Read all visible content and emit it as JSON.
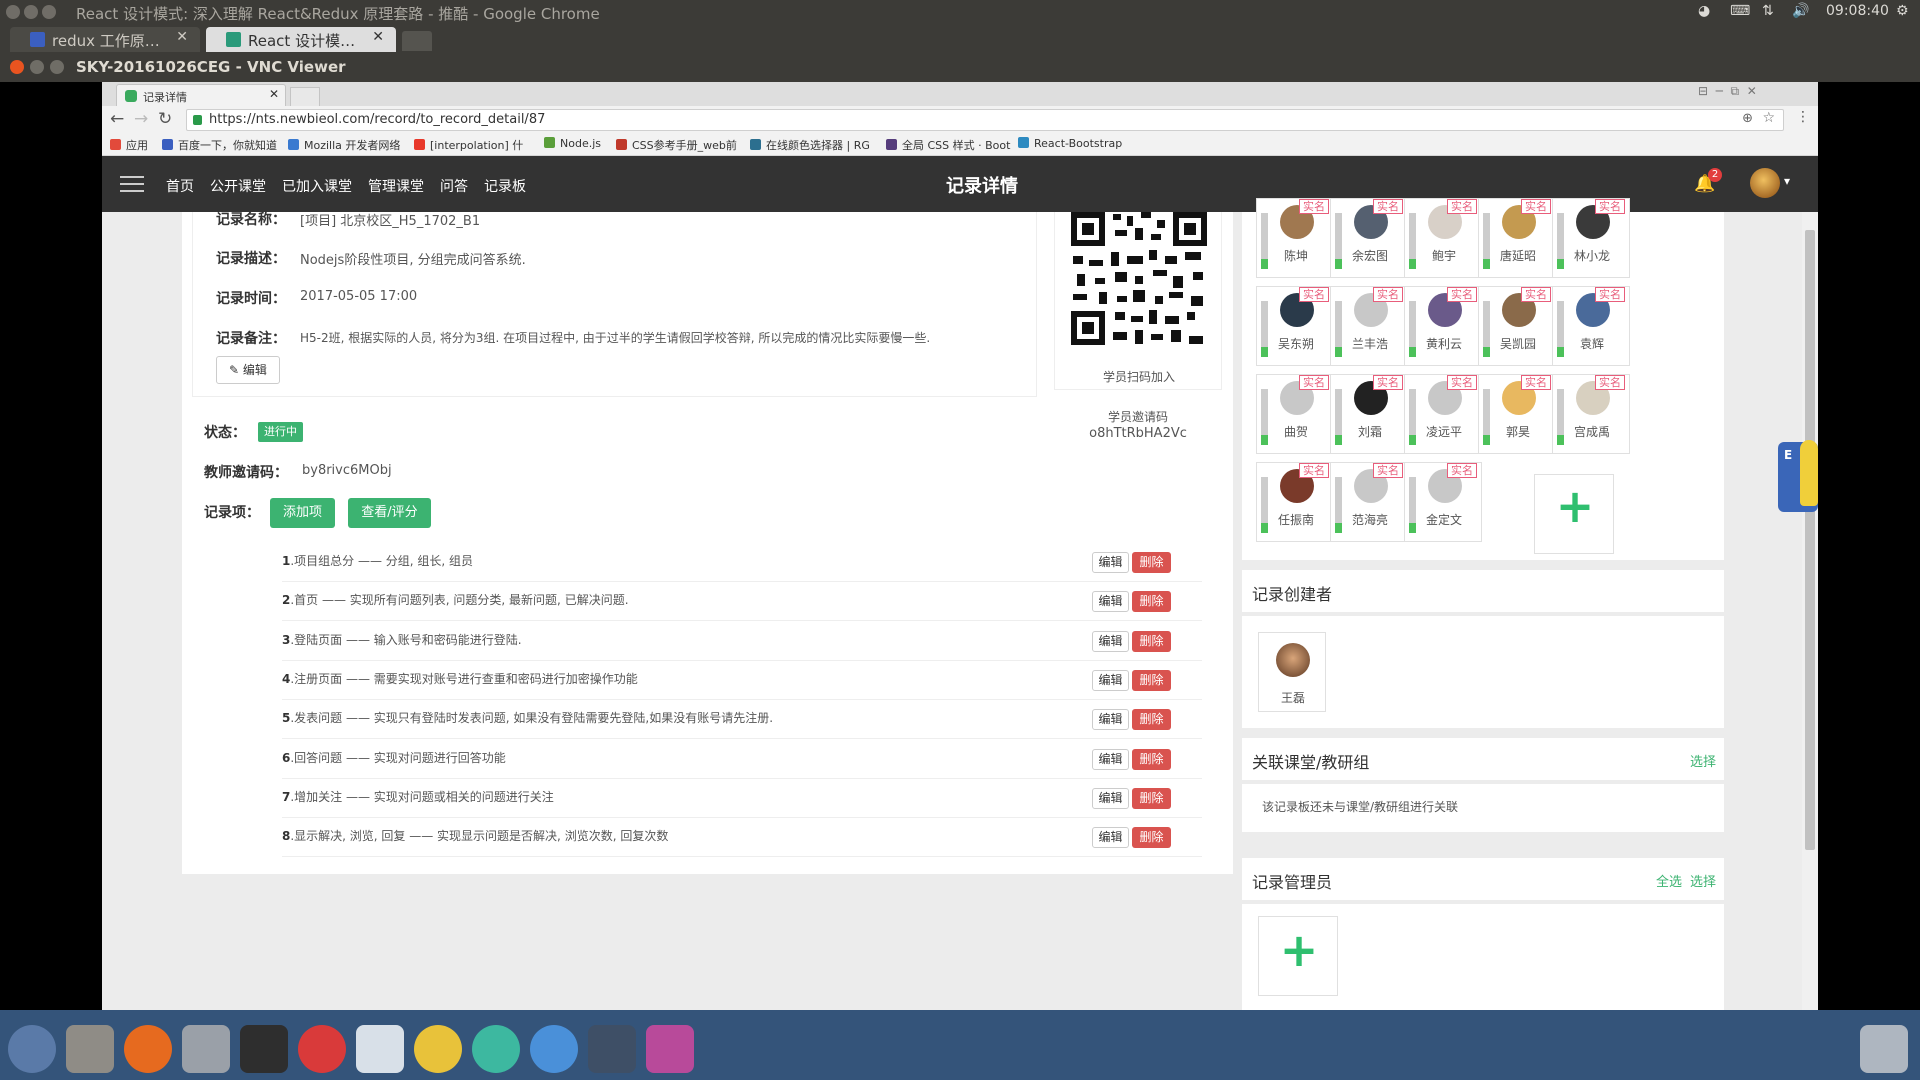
{
  "outer_window": {
    "title": "React 设计模式: 深入理解 React&Redux 原理套路 - 推酷 - Google Chrome",
    "tabs": [
      {
        "label": "redux 工作原理_百"
      },
      {
        "label": "React 设计模式: 深"
      }
    ],
    "clock": "09:08:40"
  },
  "vnc": {
    "title": "SKY-20161026CEG - VNC Viewer"
  },
  "inner_browser": {
    "tab_label": "记录详情",
    "url": "https://nts.newbieol.com/record/to_record_detail/87",
    "bookmarks": [
      "应用",
      "百度一下，你就知道",
      "Mozilla 开发者网络",
      "[interpolation] 什",
      "Node.js",
      "CSS参考手册_web前",
      "在线颜色选择器 | RG",
      "全局 CSS 样式 · Boot",
      "React-Bootstrap"
    ]
  },
  "site_nav": {
    "items": [
      "首页",
      "公开课堂",
      "已加入课堂",
      "管理课堂",
      "问答",
      "记录板"
    ],
    "page_title": "记录详情",
    "notification_count": "2"
  },
  "record": {
    "name_label": "记录名称：",
    "name_value": "[项目] 北京校区_H5_1702_B1",
    "desc_label": "记录描述：",
    "desc_value": "Nodejs阶段性项目, 分组完成问答系统.",
    "time_label": "记录时间：",
    "time_value": "2017-05-05 17:00",
    "note_label": "记录备注：",
    "note_value": "H5-2班, 根据实际的人员, 将分为3组. 在项目过程中, 由于过半的学生请假回学校答辩, 所以完成的情况比实际要慢一些.",
    "edit_label": "编辑",
    "qr_caption": "学员扫码加入",
    "student_code_label": "学员邀请码",
    "student_code": "o8hTtRbHA2Vc",
    "status_label": "状态：",
    "status_value": "进行中",
    "teacher_code_label": "教师邀请码：",
    "teacher_code": "by8rivc6MObj",
    "items_label": "记录项：",
    "add_item_label": "添加项",
    "view_rate_label": "查看/评分",
    "row_edit_label": "编辑",
    "row_delete_label": "删除",
    "items": [
      {
        "num": "1",
        "text": ".项目组总分 —— 分组, 组长, 组员"
      },
      {
        "num": "2",
        "text": ".首页 —— 实现所有问题列表, 问题分类, 最新问题, 已解决问题."
      },
      {
        "num": "3",
        "text": ".登陆页面 —— 输入账号和密码能进行登陆."
      },
      {
        "num": "4",
        "text": ".注册页面 —— 需要实现对账号进行查重和密码进行加密操作功能"
      },
      {
        "num": "5",
        "text": ".发表问题 —— 实现只有登陆时发表问题, 如果没有登陆需要先登陆,如果没有账号请先注册."
      },
      {
        "num": "6",
        "text": ".回答问题 —— 实现对问题进行回答功能"
      },
      {
        "num": "7",
        "text": ".增加关注 —— 实现对问题或相关的问题进行关注"
      },
      {
        "num": "8",
        "text": ".显示解决, 浏览, 回复 —— 实现显示问题是否解决, 浏览次数, 回复次数"
      }
    ]
  },
  "members": {
    "tag": "实名",
    "list": [
      {
        "name": "陈坤"
      },
      {
        "name": "余宏图"
      },
      {
        "name": "鲍宇"
      },
      {
        "name": "唐延昭"
      },
      {
        "name": "林小龙"
      },
      {
        "name": "吴东朔"
      },
      {
        "name": "兰丰浩"
      },
      {
        "name": "黄利云"
      },
      {
        "name": "吴凯园"
      },
      {
        "name": "袁辉"
      },
      {
        "name": "曲贺"
      },
      {
        "name": "刘霜"
      },
      {
        "name": "凌远平"
      },
      {
        "name": "郭昊"
      },
      {
        "name": "宫成禹"
      },
      {
        "name": "任振南"
      },
      {
        "name": "范海亮"
      },
      {
        "name": "金定文"
      }
    ]
  },
  "creator": {
    "title": "记录创建者",
    "name": "王磊"
  },
  "related": {
    "title": "关联课堂/教研组",
    "select": "选择",
    "empty_text": "该记录板还未与课堂/教研组进行关联"
  },
  "admins": {
    "title": "记录管理员",
    "select_all": "全选",
    "select": "选择"
  },
  "colors": {
    "nav_bg": "#333333",
    "accent_green": "#3cb371",
    "danger_red": "#d9534f",
    "tag_pink": "#e85d7b"
  }
}
